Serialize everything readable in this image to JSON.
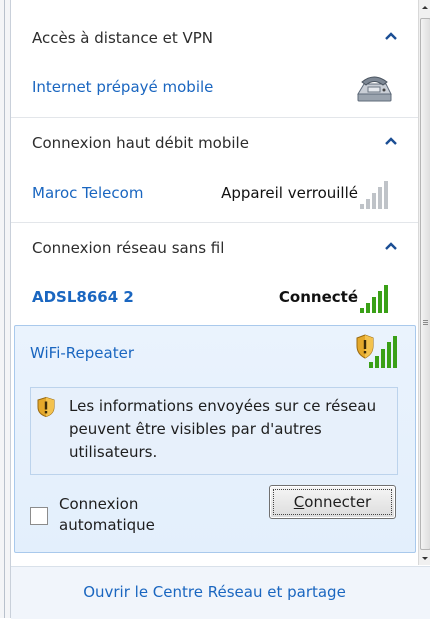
{
  "sections": {
    "remote_access": {
      "title": "Accès à distance et VPN",
      "connection_name": "Internet prépayé mobile",
      "connection_icon": "dialup-modem-icon"
    },
    "mobile_broadband": {
      "title": "Connexion haut débit mobile",
      "connection_name": "Maroc Telecom",
      "status": "Appareil verrouillé",
      "signal_icon": "signal-bars-gray-icon"
    },
    "wireless": {
      "title": "Connexion réseau sans fil",
      "connected_network": {
        "name": "ADSL8664 2",
        "status": "Connecté",
        "signal_icon": "signal-bars-green-icon"
      },
      "expanded_network": {
        "name": "WiFi-Repeater",
        "signal_icon": "signal-bars-green-with-shield-icon",
        "warning_icon": "security-shield-warning-icon",
        "warning_text": "Les informations envoyées sur ce réseau peuvent être visibles par d'autres utilisateurs.",
        "auto_connect_label": "Connexion automatique",
        "auto_connect_checked": false,
        "connect_button_prefix": "C",
        "connect_button_rest": "onnecter"
      }
    }
  },
  "footer": {
    "link": "Ouvrir le Centre Réseau et partage"
  },
  "colors": {
    "link_blue": "#1a66c0",
    "signal_green": "#3aa017",
    "panel_bg": "#e6f1fd"
  }
}
